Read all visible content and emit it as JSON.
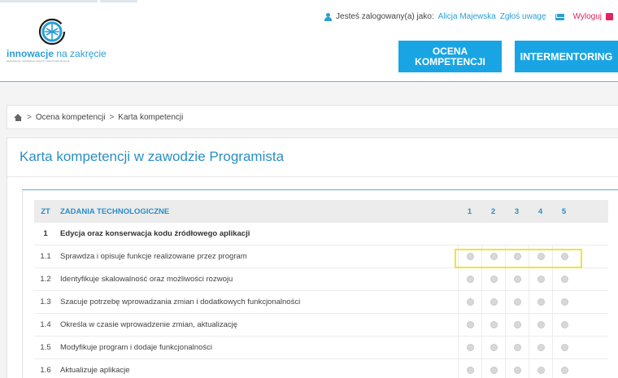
{
  "header": {
    "user_prefix": "Jesteś zalogowany(a) jako:",
    "user_name": "Alicja Majewska",
    "report_link": "Zgłoś uwagę",
    "logout": "Wyloguj",
    "logo_brand_bold": "innowacje",
    "logo_brand_rest": " na zakręcie",
    "logo_tagline": "testowanie i wdrażanie nowych metod zatrudnienia",
    "nav": [
      {
        "label_line1": "OCENA",
        "label_line2": "KOMPETENCJI"
      },
      {
        "label": "INTERMENTORING"
      }
    ],
    "colors": {
      "accent": "#19a5e3",
      "logout": "#e0245e"
    }
  },
  "breadcrumb": {
    "items": [
      "Ocena kompetencji",
      "Karta kompetencji"
    ],
    "separator": ">"
  },
  "page": {
    "title": "Karta kompetencji w zawodzie Programista"
  },
  "table": {
    "header": {
      "code": "ZT",
      "label": "ZADANIA TECHNOLOGICZNE",
      "scores": [
        "1",
        "2",
        "3",
        "4",
        "5"
      ]
    },
    "section": {
      "no": "1",
      "label": "Edycja oraz konserwacja kodu źródłowego aplikacji"
    },
    "rows": [
      {
        "no": "1.1",
        "label": "Sprawdza i opisuje funkcje realizowane przez program"
      },
      {
        "no": "1.2",
        "label": "Identyfikuje skalowalność oraz możliwości rozwoju"
      },
      {
        "no": "1.3",
        "label": "Szacuje potrzebę wprowadzania zmian i dodatkowych funkcjonalności"
      },
      {
        "no": "1.4",
        "label": "Określa w czasie wprowadzenie zmian, aktualizację"
      },
      {
        "no": "1.5",
        "label": "Modyfikuje program i dodaje funkcjonalności"
      },
      {
        "no": "1.6",
        "label": "Aktualizuje aplikacje"
      }
    ],
    "highlighted_row": "1.1"
  }
}
